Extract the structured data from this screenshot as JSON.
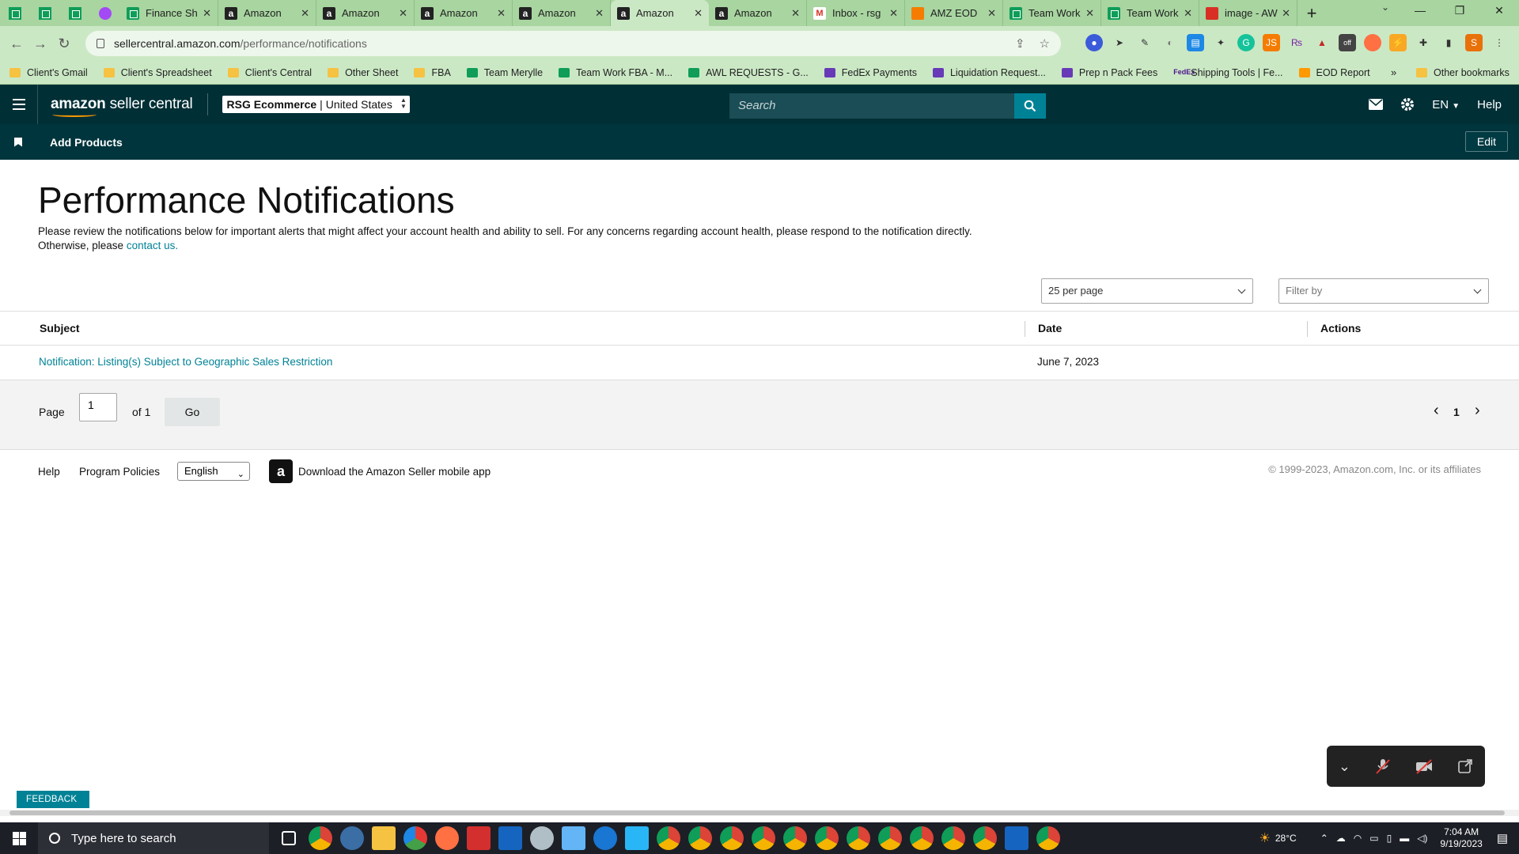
{
  "browser": {
    "tabs": [
      {
        "icon": "sheets-icon",
        "title": "Finance Sh",
        "active": false
      },
      {
        "icon": "amazon-icon",
        "title": "Amazon",
        "active": false
      },
      {
        "icon": "amazon-icon",
        "title": "Amazon",
        "active": false
      },
      {
        "icon": "amazon-icon",
        "title": "Amazon",
        "active": false
      },
      {
        "icon": "amazon-icon",
        "title": "Amazon",
        "active": false
      },
      {
        "icon": "amazon-icon",
        "title": "Amazon",
        "active": true
      },
      {
        "icon": "amazon-icon",
        "title": "Amazon",
        "active": false
      },
      {
        "icon": "gmail-icon",
        "title": "Inbox - rsg",
        "active": false
      },
      {
        "icon": "rocket-icon",
        "title": "AMZ EOD",
        "active": false
      },
      {
        "icon": "sheets-icon",
        "title": "Team Work",
        "active": false
      },
      {
        "icon": "sheets-icon",
        "title": "Team Work",
        "active": false
      },
      {
        "icon": "heart-icon",
        "title": "image - AW",
        "active": false
      }
    ],
    "url_host": "sellercentral.amazon.com",
    "url_path": "/performance/notifications",
    "profile_initial": "S",
    "bookmarks": [
      {
        "icon": "folder",
        "label": "Client's Gmail"
      },
      {
        "icon": "folder",
        "label": "Client's Spreadsheet"
      },
      {
        "icon": "folder",
        "label": "Client's Central"
      },
      {
        "icon": "folder",
        "label": "Other Sheet"
      },
      {
        "icon": "folder",
        "label": "FBA"
      },
      {
        "icon": "sheets",
        "label": "Team Merylle"
      },
      {
        "icon": "sheets",
        "label": "Team Work FBA - M..."
      },
      {
        "icon": "sheets",
        "label": "AWL REQUESTS - G..."
      },
      {
        "icon": "forms",
        "label": "FedEx Payments"
      },
      {
        "icon": "forms",
        "label": "Liquidation Request..."
      },
      {
        "icon": "forms",
        "label": "Prep n Pack Fees"
      },
      {
        "icon": "fedex",
        "label": "Shipping Tools | Fe..."
      },
      {
        "icon": "amz",
        "label": "EOD Report"
      }
    ],
    "bookmarks_more": "»",
    "other_bookmarks": "Other bookmarks"
  },
  "header": {
    "logo_bold": "amazon",
    "logo_rest": " seller central",
    "store_name": "RSG Ecommerce",
    "store_region": "United States",
    "search_placeholder": "Search",
    "language": "EN",
    "help": "Help"
  },
  "subnav": {
    "add_products": "Add Products",
    "edit": "Edit"
  },
  "main": {
    "title": "Performance Notifications",
    "intro": "Please review the notifications below for important alerts that might affect your account health and ability to sell. For any concerns regarding account health, please respond to the notification directly. Otherwise, please ",
    "contact_link": "contact us.",
    "per_page": "25 per page",
    "filter_by": "Filter by",
    "columns": {
      "subject": "Subject",
      "date": "Date",
      "actions": "Actions"
    },
    "rows": [
      {
        "subject": "Notification: Listing(s) Subject to Geographic Sales Restriction",
        "date": "June 7, 2023",
        "action": ""
      }
    ],
    "pager": {
      "page_label": "Page",
      "page_value": "1",
      "of_label": "of 1",
      "go": "Go",
      "prev": "‹",
      "current": "1",
      "next": "›"
    }
  },
  "footer": {
    "help": "Help",
    "program_policies": "Program Policies",
    "language": "English",
    "download_app": "Download the Amazon Seller mobile app",
    "copyright": "© 1999-2023, Amazon.com, Inc. or its affiliates"
  },
  "feedback": "FEEDBACK",
  "taskbar": {
    "search_placeholder": "Type here to search",
    "weather": "28°C",
    "time": "7:04 AM",
    "date": "9/19/2023"
  }
}
